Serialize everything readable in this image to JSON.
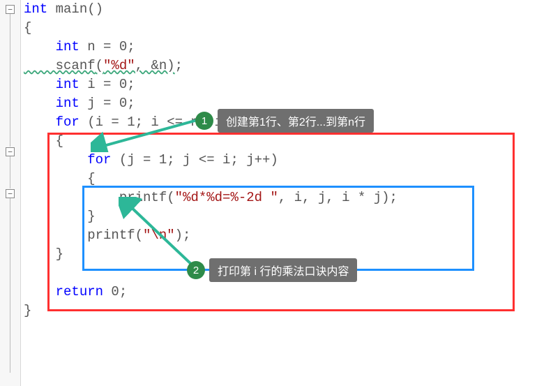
{
  "code": {
    "l1_type": "int",
    "l1_main": " main",
    "l1_paren": "()",
    "l2": "{",
    "l3_type": "    int ",
    "l3_rest": "n = 0;",
    "l4_func": "    scanf",
    "l4_p1": "(",
    "l4_str": "\"%d\"",
    "l4_mid": ", &n)",
    "l4_semi": ";",
    "l5_type": "    int ",
    "l5_rest": "i = 0;",
    "l6_type": "    int ",
    "l6_rest": "j = 0;",
    "l7_kw": "    for ",
    "l7_rest": "(i = 1; i <= n; i++)",
    "l8": "    {",
    "l9_kw": "        for ",
    "l9_rest": "(j = 1; j <= i; j++)",
    "l10": "        {",
    "l11_func": "            printf",
    "l11_p1": "(",
    "l11_str": "\"%d*%d=%-2d \"",
    "l11_rest": ", i, j, i * j);",
    "l12": "        }",
    "l13_func": "        printf",
    "l13_p1": "(",
    "l13_str": "\"\\n\"",
    "l13_rest": ");",
    "l14": "    }",
    "l15": "",
    "l16_kw": "    return ",
    "l16_rest": "0;",
    "l17": "}"
  },
  "annotations": {
    "a1_num": "1",
    "a1_text": "创建第1行、第2行...到第n行",
    "a2_num": "2",
    "a2_text": "打印第 i 行的乘法口诀内容"
  },
  "fold_symbol": "−"
}
